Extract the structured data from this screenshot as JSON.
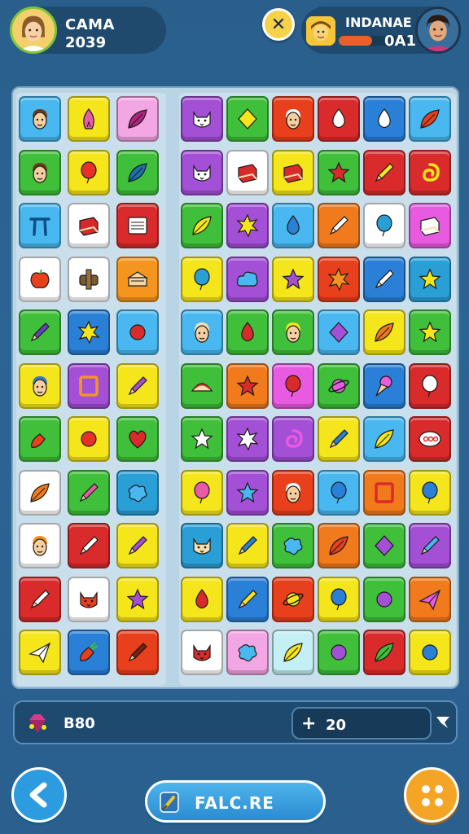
{
  "hud": {
    "player_left": {
      "name": "CAMA",
      "score": "2039"
    },
    "player_right": {
      "name": "INDANAE",
      "value": "0A1",
      "progress": 0.45
    }
  },
  "board": {
    "left_tiles": [
      [
        "#49b8f0",
        "headband-face",
        "#6b3d1e"
      ],
      [
        "#f5e51b",
        "onion",
        "#e85ba8"
      ],
      [
        "#f2a6e3",
        "feather",
        "#b02480"
      ],
      [
        "#3fbf3a",
        "elf-face",
        "#6b3d1e"
      ],
      [
        "#f5e51b",
        "balloon",
        "#e8302a"
      ],
      [
        "#3fbf3a",
        "leaf",
        "#1c6fb0"
      ],
      [
        "#49b8f0",
        "pi-arch",
        "#0c4f86"
      ],
      [
        "#ffffff",
        "book",
        "#d4282a"
      ],
      [
        "#d92b2b",
        "calendar",
        "#ffffff"
      ],
      [
        "#ffffff",
        "apple",
        "#e8401c"
      ],
      [
        "#ffffff",
        "ornament",
        "#7a5a30"
      ],
      [
        "#f59520",
        "sandwich",
        "#f7d7a0"
      ],
      [
        "#3fbf3a",
        "pencil",
        "#6a3fc7"
      ],
      [
        "#2a7fd6",
        "burst",
        "#f5e51b"
      ],
      [
        "#49b8f0",
        "dot",
        "#d92b2b"
      ],
      [
        "#f5e51b",
        "man-face",
        "#3a7ac7"
      ],
      [
        "#a34fd6",
        "square-frame",
        "#f59520"
      ],
      [
        "#f5e51b",
        "pencil",
        "#a34fd6"
      ],
      [
        "#3fbf3a",
        "carrot",
        "#e8401c"
      ],
      [
        "#f5e51b",
        "dot",
        "#e8302a"
      ],
      [
        "#3fbf3a",
        "heart",
        "#d92b2b"
      ],
      [
        "#ffffff",
        "leaf",
        "#f07a1c"
      ],
      [
        "#3fbf3a",
        "pencil",
        "#e85ba8"
      ],
      [
        "#2a9fd6",
        "splat",
        "#49b8f0"
      ],
      [
        "#ffffff",
        "man-face",
        "#f59520"
      ],
      [
        "#d92b2b",
        "pencil",
        "#ffffff"
      ],
      [
        "#f5e51b",
        "pencil",
        "#a34fd6"
      ],
      [
        "#d92b2b",
        "pencil",
        "#ffffff"
      ],
      [
        "#ffffff",
        "cat-face",
        "#e8401c"
      ],
      [
        "#f5e51b",
        "star",
        "#a34fd6"
      ],
      [
        "#f5e51b",
        "paper-plane",
        "#ffffff"
      ],
      [
        "#2a7fd6",
        "carrot",
        "#e8401c"
      ],
      [
        "#e8401c",
        "pencil",
        "#7a2010"
      ]
    ],
    "right_tiles": [
      [
        "#a34fd6",
        "cat-face",
        "#ffffff"
      ],
      [
        "#3fbf3a",
        "diamond",
        "#f5e51b"
      ],
      [
        "#e8401c",
        "man-face",
        "#ffffff"
      ],
      [
        "#d92b2b",
        "drop",
        "#ffffff"
      ],
      [
        "#2a7fd6",
        "drop",
        "#ffffff"
      ],
      [
        "#49b8f0",
        "leaf",
        "#e8401c"
      ],
      [
        "#a34fd6",
        "cat-face",
        "#ffffff"
      ],
      [
        "#ffffff",
        "book",
        "#d92b2b"
      ],
      [
        "#f5e51b",
        "book",
        "#d92b2b"
      ],
      [
        "#3fbf3a",
        "star",
        "#d92b2b"
      ],
      [
        "#d92b2b",
        "pencil",
        "#f5e51b"
      ],
      [
        "#d92b2b",
        "swirl",
        "#f5e51b"
      ],
      [
        "#3fbf3a",
        "leaf",
        "#f5e51b"
      ],
      [
        "#a34fd6",
        "burst",
        "#f5e51b"
      ],
      [
        "#49b8f0",
        "drop",
        "#2a7fd6"
      ],
      [
        "#f07a1c",
        "pencil",
        "#ffffff"
      ],
      [
        "#ffffff",
        "balloon",
        "#2a9fd6"
      ],
      [
        "#e85be0",
        "book",
        "#ffffff"
      ],
      [
        "#f5e51b",
        "balloon",
        "#2a9fd6"
      ],
      [
        "#a34fd6",
        "cloud",
        "#49b8f0"
      ],
      [
        "#f5e51b",
        "star",
        "#a34fd6"
      ],
      [
        "#e8401c",
        "burst",
        "#f59520"
      ],
      [
        "#2a7fd6",
        "pencil",
        "#ffffff"
      ],
      [
        "#2a9fd6",
        "star",
        "#f5e51b"
      ],
      [
        "#49b8f0",
        "man-face",
        "#f5e0b0"
      ],
      [
        "#3fbf3a",
        "drop",
        "#d92b2b"
      ],
      [
        "#3fbf3a",
        "man-face",
        "#f5e51b"
      ],
      [
        "#49b8f0",
        "diamond",
        "#a34fd6"
      ],
      [
        "#f5e51b",
        "leaf",
        "#f07a1c"
      ],
      [
        "#3fbf3a",
        "star",
        "#f5e51b"
      ],
      [
        "#3fbf3a",
        "taco",
        "#f5e0b0"
      ],
      [
        "#f07a1c",
        "star",
        "#d92b2b"
      ],
      [
        "#e85be0",
        "balloon",
        "#d92b2b"
      ],
      [
        "#3fbf3a",
        "planet",
        "#e85be0"
      ],
      [
        "#2a7fd6",
        "ice-cream",
        "#e85be0"
      ],
      [
        "#d92b2b",
        "balloon",
        "#ffffff"
      ],
      [
        "#3fbf3a",
        "star",
        "#ffffff"
      ],
      [
        "#a34fd6",
        "burst",
        "#ffffff"
      ],
      [
        "#a34fd6",
        "swirl",
        "#e85be0"
      ],
      [
        "#f5e51b",
        "pencil",
        "#2a7fd6"
      ],
      [
        "#49b8f0",
        "leaf",
        "#f5e51b"
      ],
      [
        "#d92b2b",
        "text-blob",
        "#ffffff"
      ],
      [
        "#f5e51b",
        "balloon",
        "#e85ba8"
      ],
      [
        "#a34fd6",
        "star",
        "#49b8f0"
      ],
      [
        "#e8401c",
        "man-face",
        "#ffffff"
      ],
      [
        "#49b8f0",
        "balloon",
        "#2a7fd6"
      ],
      [
        "#f07a1c",
        "square-frame",
        "#d92b2b"
      ],
      [
        "#f5e51b",
        "balloon",
        "#2a7fd6"
      ],
      [
        "#2a9fd6",
        "cat-face",
        "#f5e0b0"
      ],
      [
        "#f5e51b",
        "pencil",
        "#2a7fd6"
      ],
      [
        "#3fbf3a",
        "splat",
        "#49b8f0"
      ],
      [
        "#f07a1c",
        "leaf",
        "#e8401c"
      ],
      [
        "#3fbf3a",
        "diamond",
        "#a34fd6"
      ],
      [
        "#a34fd6",
        "pencil",
        "#49b8f0"
      ],
      [
        "#f5e51b",
        "drop",
        "#d92b2b"
      ],
      [
        "#2a7fd6",
        "pencil",
        "#f5e51b"
      ],
      [
        "#e8401c",
        "planet",
        "#f5e51b"
      ],
      [
        "#f5e51b",
        "balloon",
        "#2a7fd6"
      ],
      [
        "#3fbf3a",
        "dot",
        "#a34fd6"
      ],
      [
        "#f07a1c",
        "paper-plane",
        "#e85be0"
      ],
      [
        "#ffffff",
        "cat-face",
        "#d92b2b"
      ],
      [
        "#f2a6e3",
        "splat",
        "#49b8f0"
      ],
      [
        "#c4f0f5",
        "leaf",
        "#f5e51b"
      ],
      [
        "#3fbf3a",
        "dot",
        "#a34fd6"
      ],
      [
        "#d92b2b",
        "leaf",
        "#3fbf3a"
      ],
      [
        "#f5e51b",
        "dot",
        "#2a7fd6"
      ]
    ]
  },
  "info_bar": {
    "score": "B80",
    "bonus": "20"
  },
  "center_button": {
    "label": "FALC.RE"
  },
  "icons": {
    "gem": "gem-icon",
    "plus": "plus-icon",
    "arrow": "arrow-icon",
    "back": "back-arrow-icon",
    "menu": "menu-dots-icon",
    "close": "close-icon"
  },
  "colors": {
    "accent": "#2a8bd0",
    "menu": "#f5a526",
    "close": "#f6d24a"
  }
}
